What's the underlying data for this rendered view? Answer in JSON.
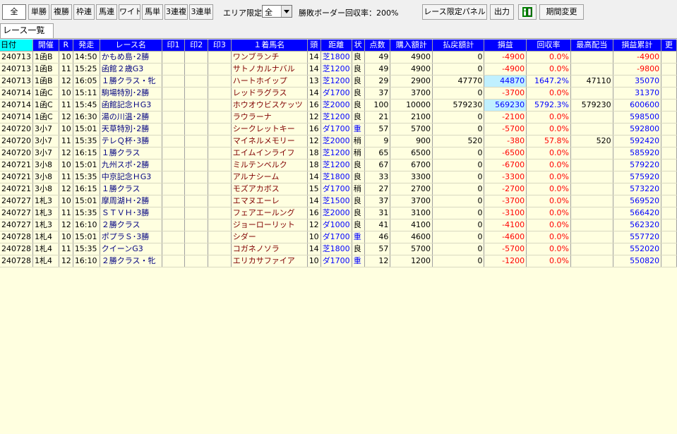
{
  "toolbar": {
    "bet_types": [
      "全",
      "単勝",
      "複勝",
      "枠連",
      "馬連",
      "ワイド",
      "馬単",
      "3連複",
      "3連単"
    ],
    "area_label": "エリア限定",
    "area_value": "全",
    "border_label": "勝敗ボーダー回収率：200%",
    "race_panel_label": "レース限定パネル",
    "output_label": "出力",
    "period_label": "期間変更"
  },
  "tab_label": "レース一覧",
  "columns": [
    "日付",
    "開催",
    "R",
    "発走",
    "レース名",
    "印1",
    "印2",
    "印3",
    "１着馬名",
    "頭",
    "距離",
    "状",
    "点数",
    "購入額計",
    "払戻額計",
    "損益",
    "回収率",
    "最高配当",
    "損益累計",
    "更"
  ],
  "rows": [
    {
      "date": "240713",
      "venue": "1函B",
      "r": "10",
      "time": "14:50",
      "race": "かもめ島･2勝",
      "horse": "ワンブランチ",
      "n": "14",
      "dist": "芝1800",
      "cond": "良",
      "pts": "49",
      "buy": "4900",
      "pay": "0",
      "pl": "-4900",
      "rate": "0.0%",
      "max": "",
      "cum": "-4900"
    },
    {
      "date": "240713",
      "venue": "1函B",
      "r": "11",
      "time": "15:25",
      "race": "函館２歳G3",
      "horse": "サトノカルナバル",
      "n": "14",
      "dist": "芝1200",
      "cond": "良",
      "pts": "49",
      "buy": "4900",
      "pay": "0",
      "pl": "-4900",
      "rate": "0.0%",
      "max": "",
      "cum": "-9800"
    },
    {
      "date": "240713",
      "venue": "1函B",
      "r": "12",
      "time": "16:05",
      "race": "１勝クラス・牝",
      "horse": "ハートホイップ",
      "n": "13",
      "dist": "芝1200",
      "cond": "良",
      "pts": "29",
      "buy": "2900",
      "pay": "47770",
      "pl": "44870",
      "rate": "1647.2%",
      "max": "47110",
      "cum": "35070"
    },
    {
      "date": "240714",
      "venue": "1函C",
      "r": "10",
      "time": "15:11",
      "race": "駒場特別･2勝",
      "horse": "レッドラグラス",
      "n": "14",
      "dist": "ダ1700",
      "cond": "良",
      "pts": "37",
      "buy": "3700",
      "pay": "0",
      "pl": "-3700",
      "rate": "0.0%",
      "max": "",
      "cum": "31370"
    },
    {
      "date": "240714",
      "venue": "1函C",
      "r": "11",
      "time": "15:45",
      "race": "函館記念ＨG3",
      "horse": "ホウオウビスケッツ",
      "n": "16",
      "dist": "芝2000",
      "cond": "良",
      "pts": "100",
      "buy": "10000",
      "pay": "579230",
      "pl": "569230",
      "rate": "5792.3%",
      "max": "579230",
      "cum": "600600"
    },
    {
      "date": "240714",
      "venue": "1函C",
      "r": "12",
      "time": "16:30",
      "race": "湯の川温･2勝",
      "horse": "ラウラーナ",
      "n": "12",
      "dist": "芝1200",
      "cond": "良",
      "pts": "21",
      "buy": "2100",
      "pay": "0",
      "pl": "-2100",
      "rate": "0.0%",
      "max": "",
      "cum": "598500"
    },
    {
      "date": "240720",
      "venue": "3小7",
      "r": "10",
      "time": "15:01",
      "race": "天草特別･2勝",
      "horse": "シークレットキー",
      "n": "16",
      "dist": "ダ1700",
      "cond": "重",
      "pts": "57",
      "buy": "5700",
      "pay": "0",
      "pl": "-5700",
      "rate": "0.0%",
      "max": "",
      "cum": "592800"
    },
    {
      "date": "240720",
      "venue": "3小7",
      "r": "11",
      "time": "15:35",
      "race": "テレＱ杯･3勝",
      "horse": "マイネルメモリー",
      "n": "12",
      "dist": "芝2000",
      "cond": "稍",
      "pts": "9",
      "buy": "900",
      "pay": "520",
      "pl": "-380",
      "rate": "57.8%",
      "max": "520",
      "cum": "592420"
    },
    {
      "date": "240720",
      "venue": "3小7",
      "r": "12",
      "time": "16:15",
      "race": "１勝クラス",
      "horse": "エイムインライフ",
      "n": "18",
      "dist": "芝1200",
      "cond": "稍",
      "pts": "65",
      "buy": "6500",
      "pay": "0",
      "pl": "-6500",
      "rate": "0.0%",
      "max": "",
      "cum": "585920"
    },
    {
      "date": "240721",
      "venue": "3小8",
      "r": "10",
      "time": "15:01",
      "race": "九州スポ･2勝",
      "horse": "ミルテンベルク",
      "n": "18",
      "dist": "芝1200",
      "cond": "良",
      "pts": "67",
      "buy": "6700",
      "pay": "0",
      "pl": "-6700",
      "rate": "0.0%",
      "max": "",
      "cum": "579220"
    },
    {
      "date": "240721",
      "venue": "3小8",
      "r": "11",
      "time": "15:35",
      "race": "中京記念ＨG3",
      "horse": "アルナシーム",
      "n": "14",
      "dist": "芝1800",
      "cond": "良",
      "pts": "33",
      "buy": "3300",
      "pay": "0",
      "pl": "-3300",
      "rate": "0.0%",
      "max": "",
      "cum": "575920"
    },
    {
      "date": "240721",
      "venue": "3小8",
      "r": "12",
      "time": "16:15",
      "race": "１勝クラス",
      "horse": "モズアカボス",
      "n": "15",
      "dist": "ダ1700",
      "cond": "稍",
      "pts": "27",
      "buy": "2700",
      "pay": "0",
      "pl": "-2700",
      "rate": "0.0%",
      "max": "",
      "cum": "573220"
    },
    {
      "date": "240727",
      "venue": "1札3",
      "r": "10",
      "time": "15:01",
      "race": "摩周湖Ｈ･2勝",
      "horse": "エマヌエーレ",
      "n": "14",
      "dist": "芝1500",
      "cond": "良",
      "pts": "37",
      "buy": "3700",
      "pay": "0",
      "pl": "-3700",
      "rate": "0.0%",
      "max": "",
      "cum": "569520"
    },
    {
      "date": "240727",
      "venue": "1札3",
      "r": "11",
      "time": "15:35",
      "race": "ＳＴＶＨ･3勝",
      "horse": "フェアエールング",
      "n": "16",
      "dist": "芝2000",
      "cond": "良",
      "pts": "31",
      "buy": "3100",
      "pay": "0",
      "pl": "-3100",
      "rate": "0.0%",
      "max": "",
      "cum": "566420"
    },
    {
      "date": "240727",
      "venue": "1札3",
      "r": "12",
      "time": "16:10",
      "race": "２勝クラス",
      "horse": "ジョーローリット",
      "n": "12",
      "dist": "ダ1000",
      "cond": "良",
      "pts": "41",
      "buy": "4100",
      "pay": "0",
      "pl": "-4100",
      "rate": "0.0%",
      "max": "",
      "cum": "562320"
    },
    {
      "date": "240728",
      "venue": "1札4",
      "r": "10",
      "time": "15:01",
      "race": "ポプラＳ･3勝",
      "horse": "シダー",
      "n": "10",
      "dist": "ダ1700",
      "cond": "重",
      "pts": "46",
      "buy": "4600",
      "pay": "0",
      "pl": "-4600",
      "rate": "0.0%",
      "max": "",
      "cum": "557720"
    },
    {
      "date": "240728",
      "venue": "1札4",
      "r": "11",
      "time": "15:35",
      "race": "クイーンG3",
      "horse": "コガネノソラ",
      "n": "14",
      "dist": "芝1800",
      "cond": "良",
      "pts": "57",
      "buy": "5700",
      "pay": "0",
      "pl": "-5700",
      "rate": "0.0%",
      "max": "",
      "cum": "552020"
    },
    {
      "date": "240728",
      "venue": "1札4",
      "r": "12",
      "time": "16:10",
      "race": "２勝クラス・牝",
      "horse": "エリカサファイア",
      "n": "10",
      "dist": "ダ1700",
      "cond": "重",
      "pts": "12",
      "buy": "1200",
      "pay": "0",
      "pl": "-1200",
      "rate": "0.0%",
      "max": "",
      "cum": "550820"
    }
  ]
}
